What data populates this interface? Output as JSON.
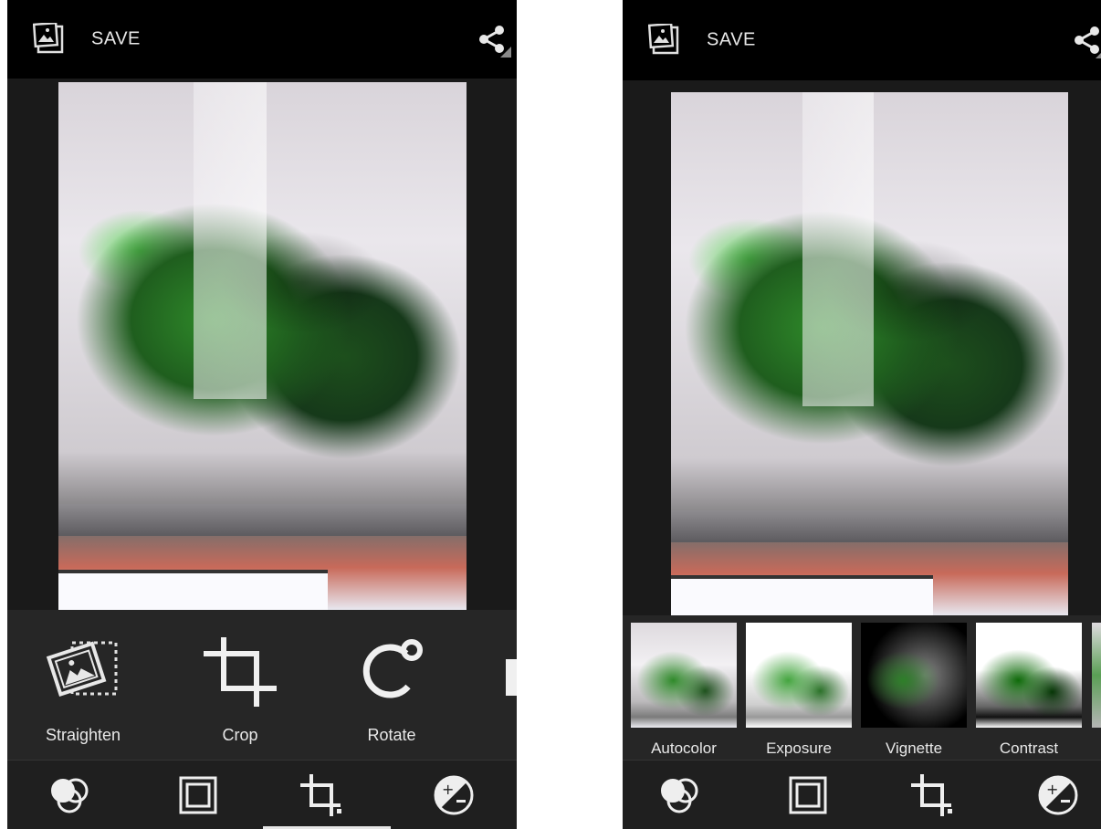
{
  "screens": [
    {
      "id": "left",
      "topbar": {
        "save_label": "SAVE",
        "save_icon": "gallery-icon",
        "share_icon": "share-icon"
      },
      "tools": [
        {
          "label": "Straighten",
          "icon": "straighten-icon"
        },
        {
          "label": "Crop",
          "icon": "crop-icon"
        },
        {
          "label": "Rotate",
          "icon": "rotate-icon"
        }
      ],
      "bottom_nav": [
        {
          "name": "filters-tab",
          "icon": "filters-icon",
          "selected": false
        },
        {
          "name": "borders-tab",
          "icon": "borders-icon",
          "selected": false
        },
        {
          "name": "geometry-tab",
          "icon": "crop-tab-icon",
          "selected": true
        },
        {
          "name": "adjust-tab",
          "icon": "exposure-icon",
          "selected": false
        }
      ]
    },
    {
      "id": "right",
      "topbar": {
        "save_label": "SAVE",
        "save_icon": "gallery-icon",
        "share_icon": "share-icon"
      },
      "filters": [
        {
          "label": "Autocolor"
        },
        {
          "label": "Exposure"
        },
        {
          "label": "Vignette"
        },
        {
          "label": "Contrast"
        }
      ],
      "bottom_nav": [
        {
          "name": "filters-tab",
          "icon": "filters-icon",
          "selected": false
        },
        {
          "name": "borders-tab",
          "icon": "borders-icon",
          "selected": false
        },
        {
          "name": "geometry-tab",
          "icon": "crop-tab-icon",
          "selected": false
        },
        {
          "name": "adjust-tab",
          "icon": "exposure-icon",
          "selected": false
        }
      ]
    }
  ],
  "colors": {
    "bar": "#000000",
    "panel": "#262626",
    "nav": "#1f1f1f",
    "text": "#e8e8e8",
    "indicator": "#e6e6e6"
  }
}
